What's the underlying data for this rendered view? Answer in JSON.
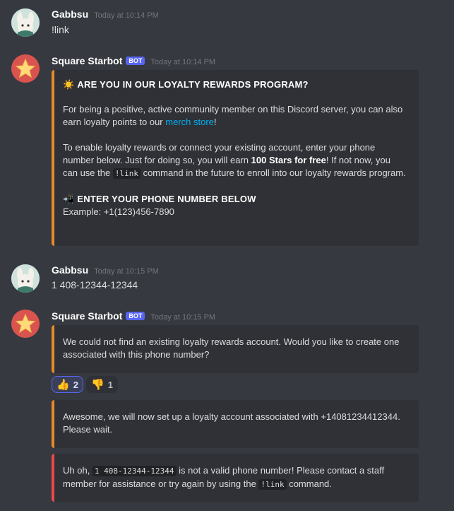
{
  "messages": [
    {
      "username": "Gabbsu",
      "timestamp": "Today at 10:14 PM",
      "text": "!link"
    },
    {
      "username": "Square Starbot",
      "bot_tag": "BOT",
      "timestamp": "Today at 10:14 PM",
      "embed": {
        "title_emoji": "☀️",
        "title": "ARE YOU IN OUR LOYALTY REWARDS PROGRAM?",
        "para1_pre": "For being a positive, active community member on this Discord server, you can also earn loyalty points to our ",
        "para1_link": "merch store",
        "para1_post": "!",
        "para2_pre": "To enable loyalty rewards or connect your existing account, enter your phone number below. Just for doing so, you will earn ",
        "para2_bold": "100 Stars for free",
        "para2_mid": "! If not now, you can use the ",
        "para2_code": "!link",
        "para2_post": " command in the future to enroll into our loyalty rewards program.",
        "sub_emoji": "📲",
        "subtitle": "ENTER YOUR PHONE NUMBER BELOW",
        "example": "Example: +1(123)456-7890"
      }
    },
    {
      "username": "Gabbsu",
      "timestamp": "Today at 10:15 PM",
      "text": "1 408-12344-12344"
    },
    {
      "username": "Square Starbot",
      "bot_tag": "BOT",
      "timestamp": "Today at 10:15 PM",
      "embeds": [
        {
          "text": "We could not find an existing loyalty rewards account. Would you like to create one associated with this phone number?"
        },
        {
          "text": "Awesome, we will now set up a loyalty account associated with +14081234412344. Please wait."
        },
        {
          "pre": "Uh oh, ",
          "code1": "1 408-12344-12344",
          "mid": " is not a valid phone number! Please contact a staff member for assistance or try again by using the ",
          "code2": "!link",
          "post": " command."
        }
      ],
      "reactions": [
        {
          "emoji": "👍",
          "count": "2"
        },
        {
          "emoji": "👎",
          "count": "1"
        }
      ]
    }
  ],
  "colors": {
    "background": "#36393f",
    "embed_bg": "#2f3136",
    "accent_orange": "#e78a28",
    "accent_red": "#e84a4a",
    "link": "#00aff4",
    "bot_tag": "#5865f2"
  }
}
